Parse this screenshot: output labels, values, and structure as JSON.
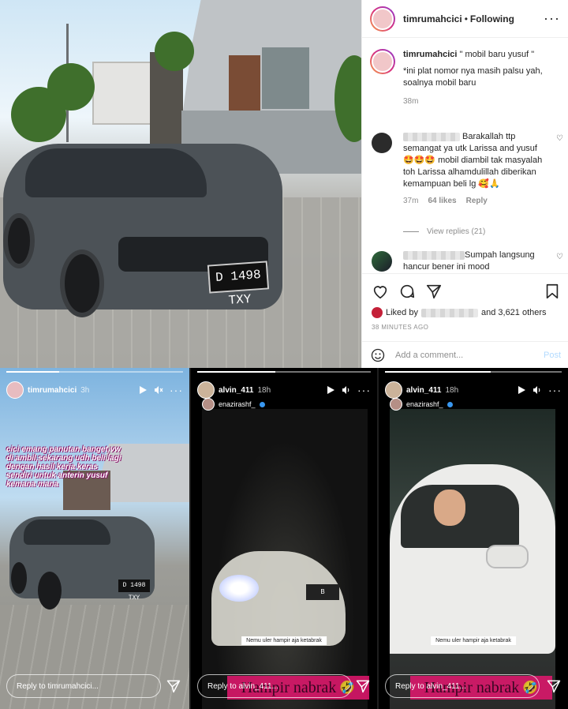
{
  "post": {
    "username": "timrumahcici",
    "separator": "•",
    "follow_status": "Following",
    "more": "···",
    "caption": {
      "username": "timrumahcici",
      "text_line1": " \" mobil baru yusuf \"",
      "text_line2": "*ini plat nomor nya masih palsu yah, soalnya mobil baru",
      "time": "38m"
    },
    "photo_plate": "D 1498 TXY",
    "comments": [
      {
        "text": " Barakallah ttp semangat ya utk Larissa and yusuf 🤩🤩🤩 mobil diambil tak masyalah toh Larissa alhamdulillah diberikan kemampuan beli lg 🥰🙏",
        "time": "37m",
        "likes": "64 likes",
        "reply": "Reply"
      },
      {
        "text": "Sumpah langsung hancur bener ini mood"
      }
    ],
    "view_replies": "View replies (21)",
    "liked_by_prefix": "Liked by",
    "liked_by_suffix": "and 3,621 others",
    "posted_ago": "38 MINUTES AGO",
    "add_comment_placeholder": "Add a comment...",
    "post_button": "Post"
  },
  "stories": [
    {
      "username": "timrumahcici",
      "time": "3h",
      "overlay_text": "cici emang panutan banget,vw di ambil,sekarang udh beli lagi dengan hasil kerja keras sendiri untuk anterin yusuf kemana mana",
      "plate": "D 1498 TXY",
      "reply_placeholder": "Reply to timrumahcici..."
    },
    {
      "username": "alvin_411",
      "time": "18h",
      "tagged": "enazirashf_",
      "plate": "B",
      "caption": "Nemu uler hampir aja ketabrak",
      "pink_text": "Hampir nabrak",
      "emoji": "🤣",
      "reply_placeholder": "Reply to alvin_411..."
    },
    {
      "username": "alvin_411",
      "time": "18h",
      "tagged": "enazirashf_",
      "caption": "Nemu uler hampir aja ketabrak",
      "pink_text": "Hampir nabrak",
      "emoji": "🤣",
      "reply_placeholder": "Reply to alvin_411..."
    }
  ],
  "colors": {
    "instagram_text": "#262626",
    "muted": "#8e8e8e",
    "post_button": "#b3dbff",
    "highlight_pink": "#e5176f"
  }
}
